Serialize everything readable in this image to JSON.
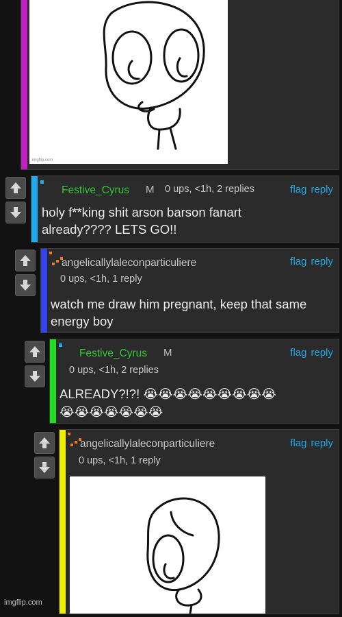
{
  "colors": {
    "background": "#121212",
    "panel": "#2b2b2b",
    "link": "#22a8e8",
    "username_green": "#35c535",
    "bars": [
      "#c020c0",
      "#22aaee",
      "#3344ee",
      "#22dd22",
      "#eeee00"
    ]
  },
  "icons": {
    "upvote": "arrow-up-icon",
    "downvote": "arrow-down-icon",
    "user_badge": "pixel-badge-icon"
  },
  "top_post": {
    "image_caption": "imgflip.com"
  },
  "actions": {
    "flag": "flag",
    "reply": "reply"
  },
  "comments": [
    {
      "username": "Festive_Cyrus",
      "mod": "M",
      "meta": "0 ups, <1h, 2 replies",
      "text": "holy f**king shit arson barson fanart already???? LETS GO!!"
    },
    {
      "username": "angelicallylaleconparticuliere",
      "mod": "",
      "meta": "0 ups, <1h, 1 reply",
      "text": "watch me draw him pregnant, keep that same energy boy"
    },
    {
      "username": "Festive_Cyrus",
      "mod": "M",
      "meta": "0 ups, <1h, 2 replies",
      "text_prefix": "ALREADY?!?!",
      "emoji_row1": "😭😭😭😭😭😭😭😭😭",
      "emoji_row2": "😭😭😭😭😭😭😭"
    },
    {
      "username": "angelicallylaleconparticuliere",
      "mod": "",
      "meta": "0 ups, <1h, 1 reply",
      "image_caption": ""
    }
  ],
  "footer": {
    "watermark": "imgflip.com"
  }
}
